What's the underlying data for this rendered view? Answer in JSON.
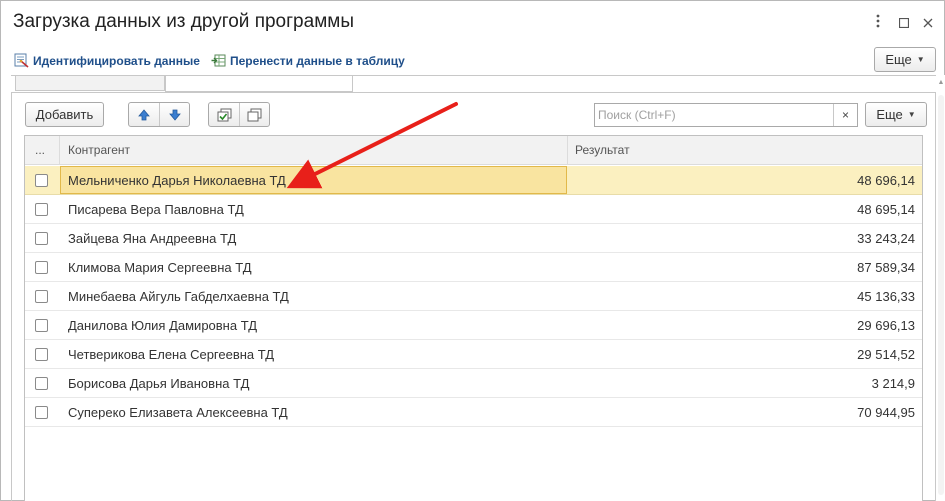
{
  "window": {
    "title": "Загрузка данных из другой программы",
    "menu_icon": "kebab-menu-icon",
    "maximize_icon": "maximize-icon",
    "close_icon": "close-icon"
  },
  "command_bar": {
    "identify_label": "Идентифицировать данные",
    "transfer_label": "Перенести данные в таблицу",
    "more_label": "Еще"
  },
  "tabs": [
    {
      "label": ""
    },
    {
      "label": ""
    }
  ],
  "toolbar": {
    "add_label": "Добавить",
    "move_up_icon": "arrow-up-icon",
    "move_down_icon": "arrow-down-icon",
    "check_all_icon": "check-all-icon",
    "uncheck_all_icon": "uncheck-all-icon",
    "more_label": "Еще"
  },
  "search": {
    "placeholder": "Поиск (Ctrl+F)",
    "value": "",
    "clear_label": "×"
  },
  "table": {
    "columns": {
      "marker": "...",
      "counterparty": "Контрагент",
      "result": "Результат"
    },
    "rows": [
      {
        "name": "Мельниченко Дарья Николаевна ТД",
        "value": "48 696,14",
        "checked": false,
        "selected": true
      },
      {
        "name": "Писарева Вера Павловна ТД",
        "value": "48 695,14",
        "checked": false,
        "selected": false
      },
      {
        "name": "Зайцева Яна Андреевна ТД",
        "value": "33 243,24",
        "checked": false,
        "selected": false
      },
      {
        "name": "Климова Мария Сергеевна ТД",
        "value": "87 589,34",
        "checked": false,
        "selected": false
      },
      {
        "name": "Минебаева Айгуль Габделхаевна ТД",
        "value": "45 136,33",
        "checked": false,
        "selected": false
      },
      {
        "name": "Данилова Юлия Дамировна ТД",
        "value": "29 696,13",
        "checked": false,
        "selected": false
      },
      {
        "name": "Четверикова Елена Сергеевна ТД",
        "value": "29 514,52",
        "checked": false,
        "selected": false
      },
      {
        "name": "Борисова Дарья Ивановна ТД",
        "value": "3 214,9",
        "checked": false,
        "selected": false
      },
      {
        "name": "Суперeко Елизавета Алексеевна ТД",
        "value": "70 944,95",
        "checked": false,
        "selected": false
      }
    ]
  },
  "annotation": {
    "arrow_color": "#e8201a"
  },
  "colors": {
    "link": "#1f4f8a",
    "selected_row": "#fbf0c0",
    "selected_cell_border": "#e2b94a"
  }
}
